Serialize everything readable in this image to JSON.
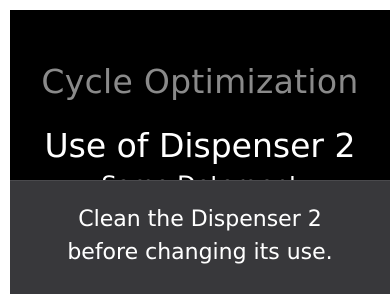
{
  "screen": {
    "menu_title": "Cycle Optimization",
    "selected_item": "Use of Dispenser 2",
    "selected_value": "Same Detergent"
  },
  "toast": {
    "line1": "Clean the Dispenser 2",
    "line2": "before changing its use."
  },
  "colors": {
    "screen_background": "#000000",
    "toast_background": "#38383b",
    "title_gray": "#8a8a8a",
    "text_white": "#ffffff"
  }
}
